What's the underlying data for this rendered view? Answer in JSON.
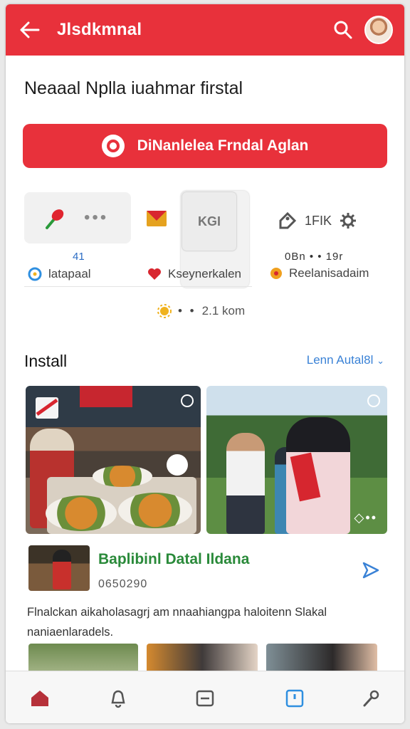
{
  "app_bar": {
    "title": "Jlsdkmnal",
    "color": "#e8313b",
    "icons": [
      "back-arrow-icon",
      "search-icon",
      "avatar"
    ]
  },
  "headline": "Neaaal Nplla iuahmar firstal",
  "primary_button": {
    "label": "DiNanlelea Frndal Aglan",
    "icon": "ring-icon"
  },
  "categories": [
    {
      "icon": "pin-icon",
      "count": "41",
      "label": "latapaal"
    },
    {
      "icon": "heart-icon",
      "label": "Kseynerkalen"
    },
    {
      "icon": "photo-tile-icon",
      "tile_text": "KGI"
    },
    {
      "icon": "tag-icon",
      "text": "1FIK",
      "stat": "0Bn • • 19r",
      "label": "Reelanisadaim"
    }
  ],
  "distance": {
    "text": "2.1 kom"
  },
  "section": {
    "title": "Install",
    "link": "Lenn Autal8l"
  },
  "event": {
    "title": "Baplibinl Datal Ildana",
    "subtitle": "0650290",
    "description": "Flnalckan aikaholasagrj am nnaahiangpa haloitenn Slakal naniaenlaradels."
  },
  "bottom_nav": [
    "home-icon",
    "notifications-icon",
    "calendar-icon",
    "bookmark-icon",
    "tools-icon"
  ]
}
